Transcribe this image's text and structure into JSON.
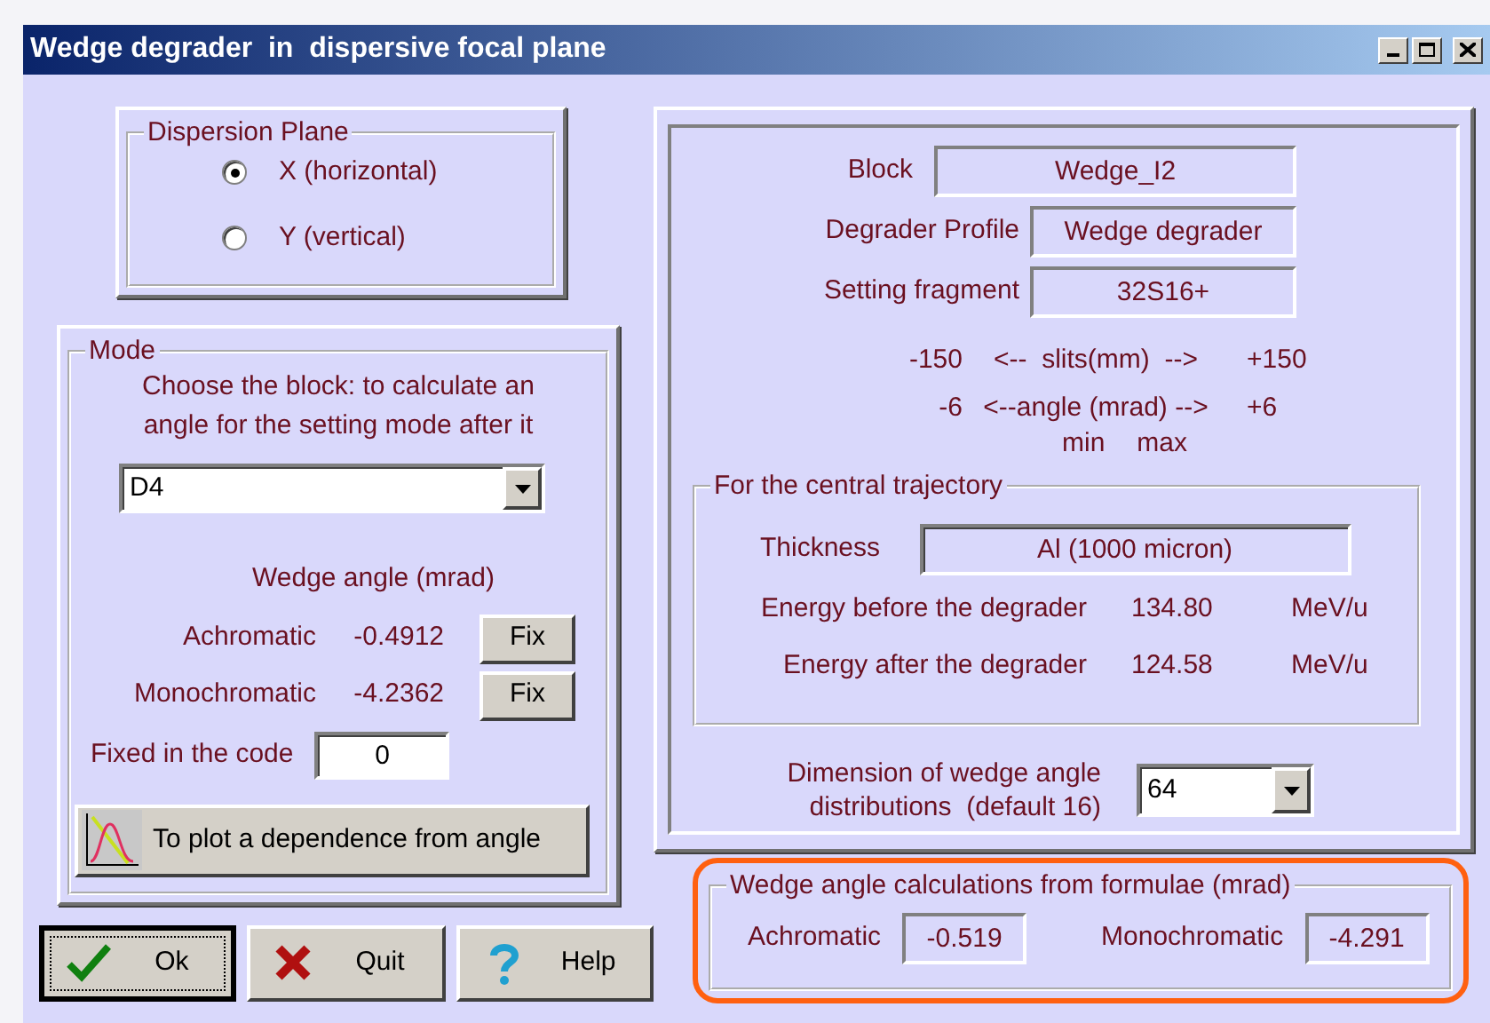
{
  "window": {
    "title": "Wedge degrader  in  dispersive focal plane"
  },
  "dispersion_plane": {
    "legend": "Dispersion Plane",
    "options": [
      {
        "label": "X (horizontal)",
        "selected": true
      },
      {
        "label": "Y (vertical)",
        "selected": false
      }
    ]
  },
  "mode": {
    "legend": "Mode",
    "instruction": "Choose the block: to calculate an\nangle for the setting mode after it",
    "block_select": {
      "value": "D4"
    },
    "wedge_angle_heading": "Wedge angle (mrad)",
    "angles": [
      {
        "label": "Achromatic",
        "value": "-0.4912",
        "button": "Fix"
      },
      {
        "label": "Monochromatic",
        "value": "-4.2362",
        "button": "Fix"
      }
    ],
    "fixed_in_code": {
      "label": "Fixed in the code",
      "value": "0"
    },
    "plot_button": "To plot a dependence from angle"
  },
  "buttons": [
    {
      "kind": "ok",
      "label": "Ok",
      "focused": true
    },
    {
      "kind": "quit",
      "label": "Quit",
      "focused": false
    },
    {
      "kind": "help",
      "label": "Help",
      "focused": false
    }
  ],
  "info": {
    "fields": [
      {
        "label": "Block",
        "value": "Wedge_I2",
        "kind": "wide"
      },
      {
        "label": "Degrader Profile",
        "value": "Wedge degrader",
        "kind": "narrow"
      },
      {
        "label": "Setting fragment",
        "value": "32S16+",
        "kind": "narrow"
      }
    ],
    "ranges": [
      {
        "min": "-150",
        "caption": "<--  slits(mm)  -->",
        "max": "+150"
      },
      {
        "min": "-6",
        "caption": "<--angle (mrad) -->",
        "max": "+6"
      }
    ],
    "range_labels": [
      "min",
      "max"
    ],
    "central_trajectory": {
      "legend": "For the central trajectory",
      "thickness": {
        "label": "Thickness",
        "value": "Al (1000 micron)"
      },
      "energies": [
        {
          "label": "Energy before the degrader",
          "value": "134.80",
          "unit": "MeV/u"
        },
        {
          "label": "Energy after the degrader",
          "value": "124.58",
          "unit": "MeV/u"
        }
      ]
    },
    "dimension": {
      "label": "Dimension of wedge angle\ndistributions  (default 16)",
      "value": "64"
    }
  },
  "formulae": {
    "legend": "Wedge angle calculations from formulae (mrad)",
    "highlighted": true,
    "results": [
      {
        "label": "Achromatic",
        "value": "-0.519"
      },
      {
        "label": "Monochromatic",
        "value": "-4.291"
      }
    ]
  }
}
